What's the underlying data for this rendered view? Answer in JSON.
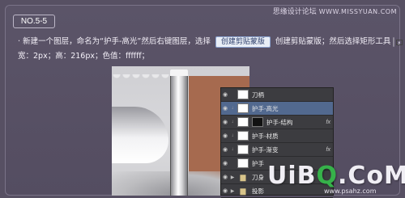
{
  "step_label": "NO.5-5",
  "watermark": {
    "site_name": "思缘设计论坛",
    "url": "WWW.MISSYUAN.COM"
  },
  "instruction": {
    "bullet": "·",
    "part1": "新建一个图层，命名为“护手-高光”然后右键图层，选择",
    "button_label": "创建剪贴蒙版",
    "part2": "创建剪贴蒙版；然后选择矩形工具",
    "part3": "，",
    "line2": "宽：2px；高：216px；色值：ffffff；"
  },
  "layers": [
    {
      "name": "刀柄",
      "type": "layer",
      "selected": false,
      "fx": false,
      "clipped": false,
      "mask": false
    },
    {
      "name": "护手-高光",
      "type": "layer",
      "selected": true,
      "fx": false,
      "clipped": true,
      "mask": false
    },
    {
      "name": "护手-结构",
      "type": "layer",
      "selected": false,
      "fx": true,
      "clipped": true,
      "mask": true
    },
    {
      "name": "护手-材质",
      "type": "layer",
      "selected": false,
      "fx": false,
      "clipped": true,
      "mask": false
    },
    {
      "name": "护手-渐变",
      "type": "layer",
      "selected": false,
      "fx": true,
      "clipped": true,
      "mask": false
    },
    {
      "name": "护手",
      "type": "layer",
      "selected": false,
      "fx": false,
      "clipped": false,
      "mask": false
    },
    {
      "name": "刀身",
      "type": "folder",
      "selected": false,
      "fx": false,
      "clipped": false,
      "mask": false
    },
    {
      "name": "投影",
      "type": "folder",
      "selected": false,
      "fx": false,
      "clipped": false,
      "mask": false
    },
    {
      "name": "背景",
      "type": "folder",
      "selected": false,
      "fx": false,
      "clipped": false,
      "mask": false
    }
  ],
  "fx_label": "fx",
  "logo": {
    "text_a": "UiB",
    "text_o": "Q",
    "text_b": ".CoM",
    "url": "www.psahz.com"
  },
  "colors": {
    "background": "#575063",
    "selected_layer": "#52698f",
    "logo_green": "#36b24a",
    "guard_brown": "#a66a4f"
  }
}
